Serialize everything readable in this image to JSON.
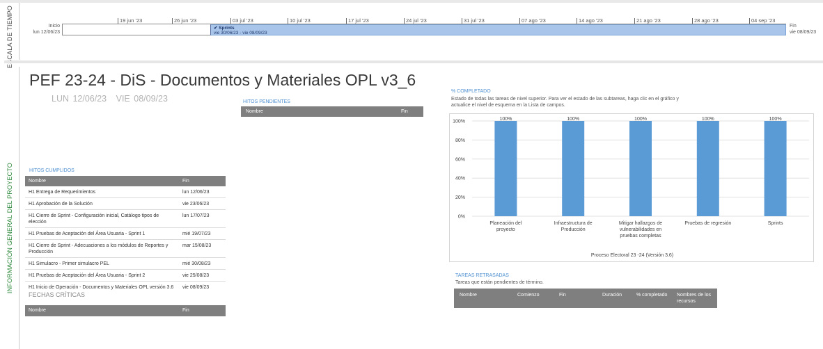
{
  "timeline": {
    "side_label": "ESCALA DE TIEMPO",
    "start_label": "Inicio",
    "start_date": "lun 12/06/23",
    "end_label": "Fin",
    "end_date": "vie 08/09/23",
    "ticks": [
      "19 jun '23",
      "26 jun '23",
      "03 jul '23",
      "10 jul '23",
      "17 jul '23",
      "24 jul '23",
      "31 jul '23",
      "07 ago '23",
      "14 ago '23",
      "21 ago '23",
      "28 ago '23",
      "04 sep '23"
    ],
    "sprint": {
      "icon": "checkmark-icon",
      "name": "Sprints",
      "dates": "vie 30/06/23 - vie 08/09/23"
    }
  },
  "project": {
    "side_label": "INFORMACIÓN GENERAL DEL PROYECTO",
    "title": "PEF 23-24 - DiS - Documentos y Materiales OPL v3_6",
    "start": "LUN 12/06/23",
    "end": "VIE 08/09/23"
  },
  "hitos_pendientes": {
    "label": "HITOS PENDIENTES",
    "headers": [
      "Nombre",
      "Fin"
    ]
  },
  "hitos_cumplidos": {
    "label": "HITOS CUMPLIDOS",
    "headers": [
      "Nombre",
      "Fin"
    ],
    "rows": [
      [
        "H1 Entrega de Requerimientos",
        "lun 12/06/23"
      ],
      [
        "H1 Aprobación de la Solución",
        "vie 23/06/23"
      ],
      [
        "H1 Cierre de Sprint - Configuración inicial, Catálogo tipos de elección",
        "lun 17/07/23"
      ],
      [
        "H1 Pruebas de Aceptación del Área Usuaria - Sprint 1",
        "mié 19/07/23"
      ],
      [
        "H1 Cierre de Sprint - Adecuaciones a los módulos de Reportes y Producción",
        "mar 15/08/23"
      ],
      [
        "H1 Simulacro - Primer simulacro PEL",
        "mié 30/08/23"
      ],
      [
        "H1 Pruebas de Aceptación del Área Usuaria - Sprint 2",
        "vie 25/08/23"
      ],
      [
        "H1 Inicio de Operación - Documentos y Materiales OPL versión 3.6",
        "vie 08/09/23"
      ]
    ]
  },
  "fechas_criticas": {
    "label": "FECHAS CRÍTICAS",
    "headers": [
      "Nombre",
      "Fin"
    ]
  },
  "completado": {
    "label": "% COMPLETADO",
    "description": "Estado de todas las tareas de nivel superior. Para ver el estado de las subtareas, haga clic en el gráfico y actualice el nivel de esquema en la Lista de campos."
  },
  "tareas_retrasadas": {
    "label": "TAREAS RETRASADAS",
    "subtitle": "Tareas que están pendientes de término.",
    "headers": [
      "Nombre",
      "Comienzo",
      "Fin",
      "Duración",
      "% completado",
      "Nombres de los recursos"
    ]
  },
  "chart_data": {
    "type": "bar",
    "categories": [
      "Planeación del proyecto",
      "Infraestructura de Producción",
      "Mitigar hallazgos de vulnerabilidades en pruebas completas",
      "Pruebas de regresión",
      "Sprints"
    ],
    "values": [
      100,
      100,
      100,
      100,
      100
    ],
    "data_labels": [
      "100%",
      "100%",
      "100%",
      "100%",
      "100%"
    ],
    "y_ticks": [
      "0%",
      "20%",
      "40%",
      "60%",
      "80%",
      "100%"
    ],
    "ylim": [
      0,
      100
    ],
    "xlabel": "Proceso Electoral 23 -24 (Versión 3.6)",
    "grid": true,
    "color": "#5b9bd5"
  }
}
